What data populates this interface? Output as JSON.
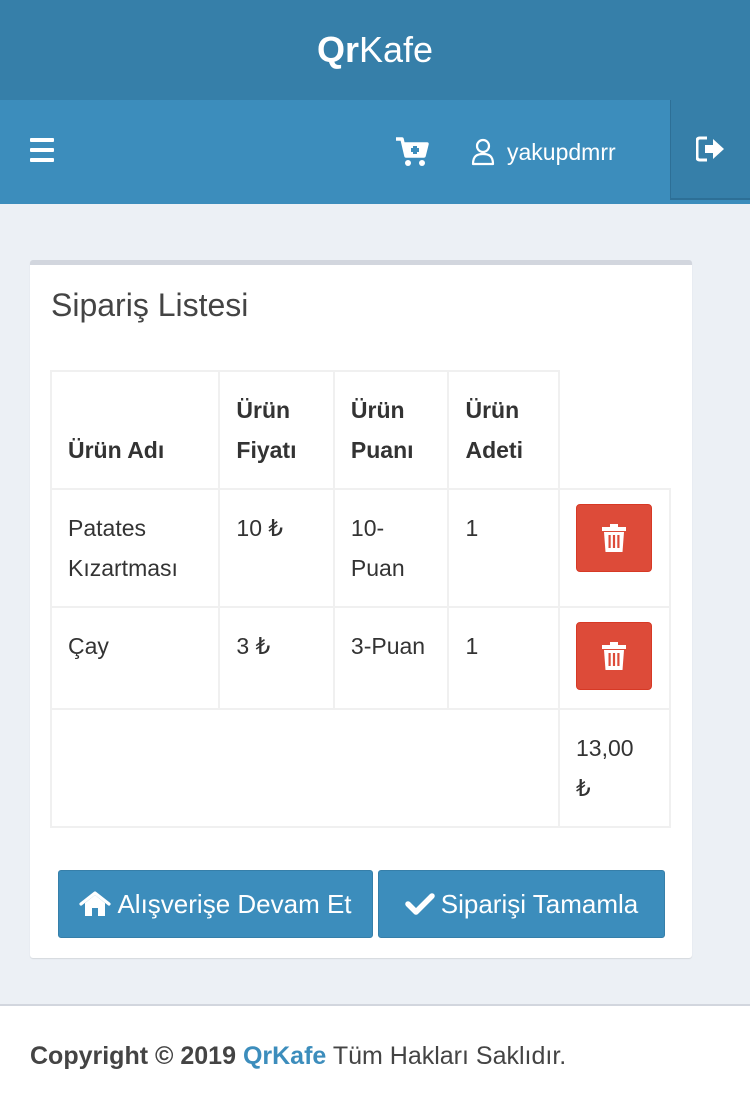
{
  "brand": {
    "part1": "Qr",
    "part2": "Kafe"
  },
  "navbar": {
    "username": "yakupdmrr"
  },
  "order_box": {
    "title": "Sipariş Listesi",
    "columns": [
      "Ürün Adı",
      "Ürün Fiyatı",
      "Ürün Puanı",
      "Ürün Adeti"
    ],
    "rows": [
      {
        "name": "Patates Kızartması",
        "price": "10 ₺",
        "points": "10-Puan",
        "qty": "1"
      },
      {
        "name": "Çay",
        "price": "3 ₺",
        "points": "3-Puan",
        "qty": "1"
      }
    ],
    "total": "13,00 ₺"
  },
  "actions": {
    "continue_label": "Alışverişe Devam Et",
    "complete_label": "Siparişi Tamamla"
  },
  "footer": {
    "copyright": "Copyright © 2019",
    "brand": "QrKafe",
    "rights": "Tüm Hakları Saklıdır."
  },
  "colors": {
    "header_dark": "#367fa9",
    "navbar": "#3c8dbc",
    "danger": "#dd4b39",
    "primary": "#3c8dbc"
  }
}
